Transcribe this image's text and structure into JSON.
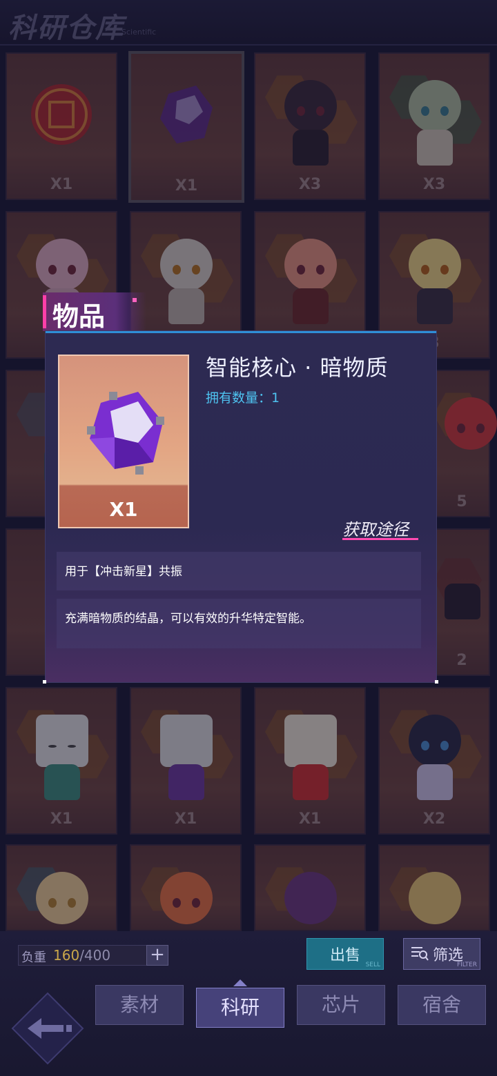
{
  "header": {
    "title": "科研仓库",
    "subtitle": "Scientific"
  },
  "grid": {
    "rows": [
      [
        "X1",
        "X1",
        "X3",
        "X3"
      ],
      [
        "",
        "",
        "",
        "3"
      ],
      [
        "",
        "",
        "",
        "5"
      ],
      [
        "",
        "",
        "",
        "2"
      ],
      [
        "X1",
        "X1",
        "X1",
        "X2"
      ],
      [
        "",
        "",
        "",
        ""
      ]
    ]
  },
  "modal": {
    "tag": "物品",
    "item_name": "智能核心 · 暗物质",
    "owned_label": "拥有数量：",
    "owned_count": "1",
    "card_qty": "X1",
    "acquire_link": "获取途径",
    "description_1": "用于【冲击新星】共振",
    "description_2": "充满暗物质的结晶，可以有效的升华特定智能。"
  },
  "bottom": {
    "capacity_label": "负重",
    "capacity_current": "160",
    "capacity_max": "/400",
    "plus_label": "+",
    "sell": {
      "label": "出售",
      "en": "SELL"
    },
    "filter": {
      "label": "筛选",
      "en": "FILTER"
    },
    "tabs": [
      {
        "label": "素材",
        "active": false
      },
      {
        "label": "科研",
        "active": true
      },
      {
        "label": "芯片",
        "active": false
      },
      {
        "label": "宿舍",
        "active": false
      }
    ]
  },
  "colors": {
    "accent_pink": "#ff3fa8",
    "accent_blue": "#2f8fd8",
    "owned_text": "#4ec3f0"
  },
  "icons": [
    "fu-seal-icon",
    "crystal-icon",
    "filter-icon",
    "back-arrow-icon"
  ]
}
